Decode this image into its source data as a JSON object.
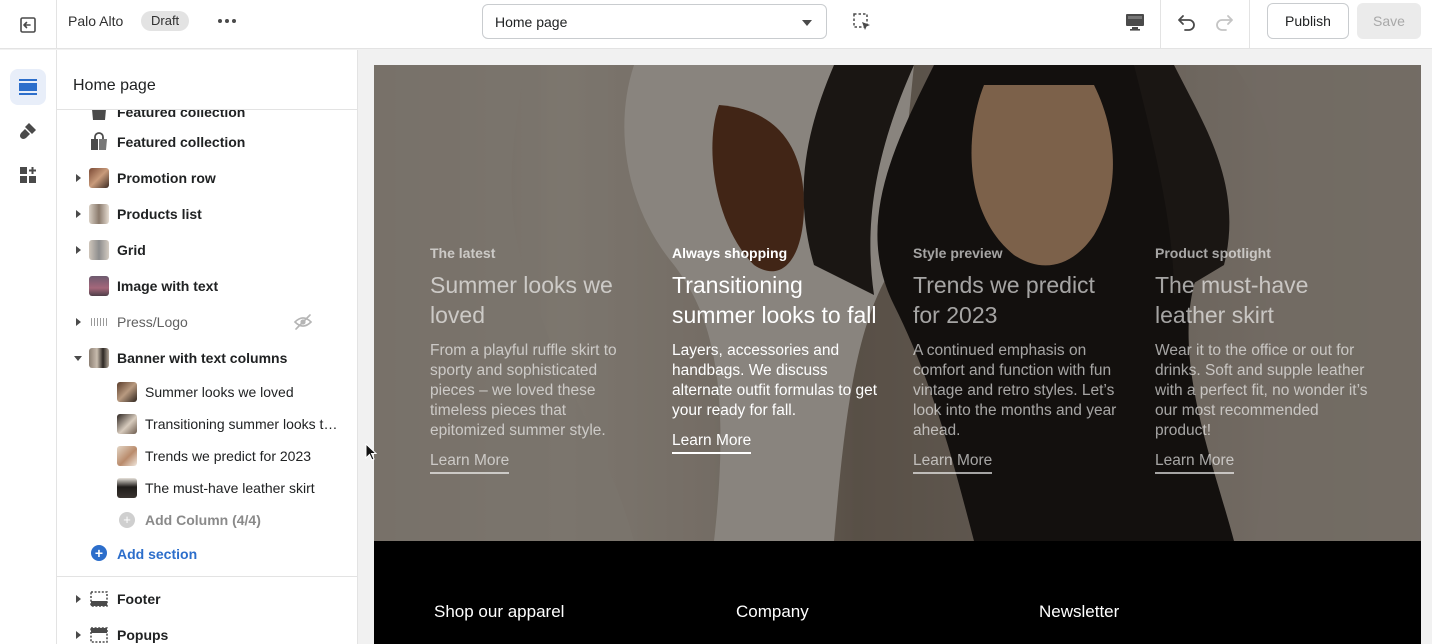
{
  "topbar": {
    "store_name": "Palo Alto",
    "status_badge": "Draft",
    "page_select_value": "Home page",
    "publish_label": "Publish",
    "save_label": "Save"
  },
  "sidebar": {
    "title": "Home page",
    "sections": [
      {
        "label": "Featured collection",
        "expandable": false,
        "thumb": "bag-icon"
      },
      {
        "label": "Promotion row",
        "expandable": true
      },
      {
        "label": "Products list",
        "expandable": true
      },
      {
        "label": "Grid",
        "expandable": true
      },
      {
        "label": "Image with text",
        "expandable": false
      },
      {
        "label": "Press/Logo",
        "expandable": true,
        "hidden": true
      },
      {
        "label": "Banner with text columns",
        "expandable": true,
        "expanded": true
      }
    ],
    "banner_columns": [
      {
        "label": "Summer looks we loved"
      },
      {
        "label": "Transitioning summer looks to fall"
      },
      {
        "label": "Trends we predict for 2023"
      },
      {
        "label": "The must-have leather skirt"
      }
    ],
    "add_column_label": "Add Column (4/4)",
    "add_section_label": "Add section",
    "footer_label": "Footer",
    "popups_label": "Popups"
  },
  "preview": {
    "columns": [
      {
        "kicker": "The latest",
        "heading": "Summer looks we loved",
        "body": "From a playful ruffle skirt to sporty and sophisticated pieces – we loved these timeless pieces that epitomized summer style.",
        "link": "Learn More"
      },
      {
        "kicker": "Always shopping",
        "heading": "Transitioning summer looks to fall",
        "body": "Layers, accessories and handbags. We discuss alternate outfit formulas to get your ready for fall.",
        "link": "Learn More"
      },
      {
        "kicker": "Style preview",
        "heading": "Trends we predict for 2023",
        "body": "A continued emphasis on comfort and function with fun vintage and retro styles. Let’s look into the months and year ahead.",
        "link": "Learn More"
      },
      {
        "kicker": "Product spotlight",
        "heading": "The must-have leather skirt",
        "body": "Wear it to the office or out for drinks. Soft and supple leather with a perfect fit, no wonder it’s our most recommended product!",
        "link": "Learn More"
      }
    ],
    "footer": {
      "col1": "Shop our apparel",
      "col2": "Company",
      "col3": "Newsletter"
    }
  },
  "colors": {
    "accent": "#2c6ecb",
    "active_rail_bg": "#e8eef9"
  }
}
